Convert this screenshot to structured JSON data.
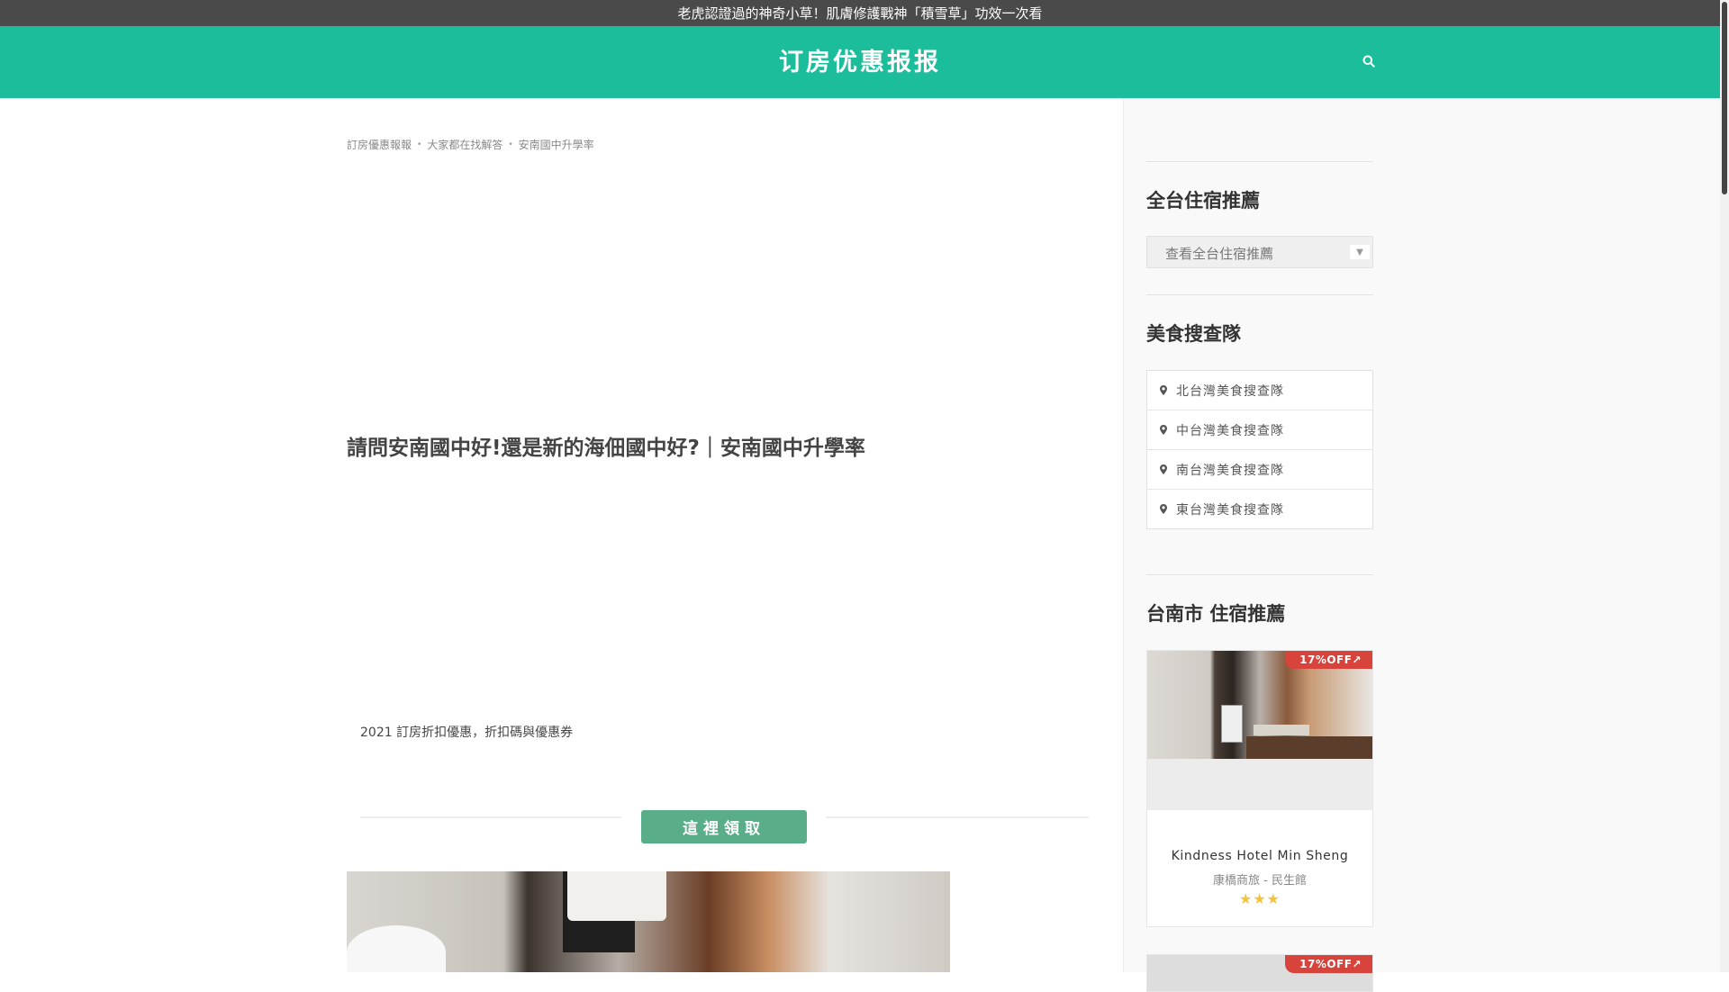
{
  "promo_bar": {
    "text": "老虎認證過的神奇小草！肌膚修護戰神「積雪草」功效一次看"
  },
  "header": {
    "logo": "订房优惠报报",
    "search_icon": "search-icon"
  },
  "breadcrumb": [
    "訂房優惠報報",
    "大家都在找解答",
    "安南國中升學率"
  ],
  "article": {
    "title": "請問安南國中好!還是新的海佃國中好?｜安南國中升學率",
    "promo_text": "2021 訂房折扣優惠，折扣碼與優惠券",
    "claim_button": "這裡領取"
  },
  "sidebar": {
    "lodging_widget": {
      "title": "全台住宿推薦",
      "select_placeholder": "查看全台住宿推薦"
    },
    "food_widget": {
      "title": "美食搜查隊",
      "items": [
        "北台灣美食搜查隊",
        "中台灣美食搜查隊",
        "南台灣美食搜查隊",
        "東台灣美食搜查隊"
      ]
    },
    "hotel_widget": {
      "title": "台南市 住宿推薦",
      "cards": [
        {
          "discount": "17%OFF↗",
          "name": "Kindness Hotel Min Sheng",
          "subtitle": "康橋商旅 - 民生館",
          "stars": "★★★"
        },
        {
          "discount": "17%OFF↗"
        }
      ]
    }
  },
  "colors": {
    "header_bg": "#1bbd9b",
    "claim_button_bg": "#5aad89",
    "discount_bg": "#d8443c",
    "promo_bar_bg": "#4a4a4a"
  }
}
